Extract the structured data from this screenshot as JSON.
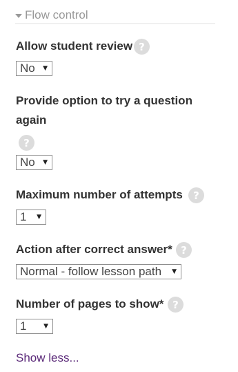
{
  "section": {
    "title": "Flow control",
    "icon": "caret-down-icon"
  },
  "fields": {
    "student_review": {
      "label": "Allow student review",
      "value": "No"
    },
    "try_again": {
      "label_line1": "Provide option to try a question",
      "label_line2": "again",
      "value": "No"
    },
    "max_attempts": {
      "label": "Maximum number of attempts",
      "value": "1"
    },
    "correct_action": {
      "label": "Action after correct answer",
      "required": "*",
      "value": "Normal - follow lesson path"
    },
    "pages_to_show": {
      "label": "Number of pages to show",
      "required": "*",
      "value": "1"
    }
  },
  "help_glyph": "?",
  "show_less": "Show less...",
  "colors": {
    "link": "#5c2b7a",
    "help_icon": "#dcdcdc",
    "header_text": "#999999"
  }
}
